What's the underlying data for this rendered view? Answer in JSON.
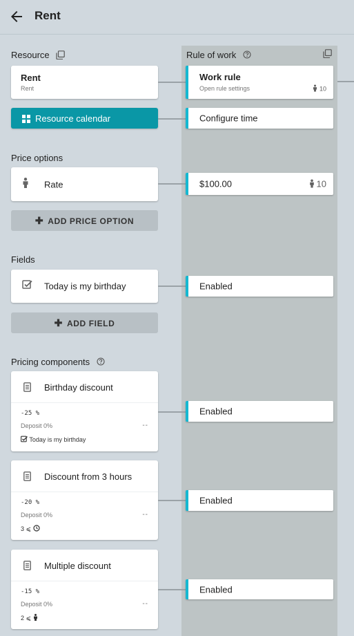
{
  "appbar": {
    "title": "Rent"
  },
  "resource": {
    "section_label": "Resource",
    "card_title": "Rent",
    "card_subtitle": "Rent",
    "calendar_button": "Resource calendar"
  },
  "rule_of_work": {
    "label": "Rule of work",
    "work_rule_title": "Work rule",
    "work_rule_subtitle": "Open rule settings",
    "work_rule_count": "10",
    "configure_time": "Configure time"
  },
  "price_options": {
    "section_label": "Price options",
    "items": [
      {
        "label": "Rate",
        "icon": "person-icon",
        "rule_value": "$100.00",
        "rule_count": "10"
      }
    ],
    "add_button": "ADD PRICE OPTION"
  },
  "fields": {
    "section_label": "Fields",
    "items": [
      {
        "label": "Today is my birthday",
        "icon": "checkbox-icon",
        "rule_value": "Enabled"
      }
    ],
    "add_button": "ADD FIELD"
  },
  "pricing_components": {
    "section_label": "Pricing components",
    "items": [
      {
        "title": "Birthday discount",
        "percent": "-25 %",
        "deposit": "Deposit 0%",
        "dash": "--",
        "condition": "Today is my birthday",
        "condition_icon": "checkbox-icon",
        "rule_value": "Enabled"
      },
      {
        "title": "Discount from 3 hours",
        "percent": "-20 %",
        "deposit": "Deposit 0%",
        "dash": "--",
        "condition": "3 ⩽",
        "condition_icon": "clock-icon",
        "rule_value": "Enabled"
      },
      {
        "title": "Multiple discount",
        "percent": "-15 %",
        "deposit": "Deposit 0%",
        "dash": "--",
        "condition": "2 ⩽",
        "condition_icon": "person-icon",
        "rule_value": "Enabled"
      }
    ]
  },
  "colors": {
    "accent": "#0a97a6",
    "rule_border": "#15b8d1",
    "background": "#d0d8de",
    "column": "#bdc4c5"
  }
}
